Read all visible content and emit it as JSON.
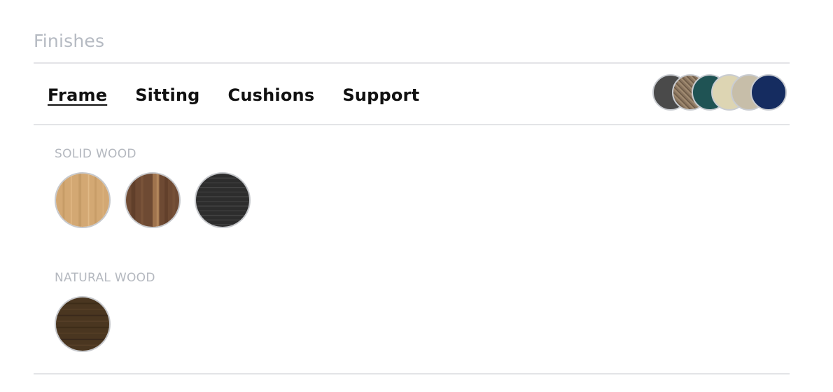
{
  "section": {
    "title": "Finishes"
  },
  "tabs": [
    {
      "label": "Frame",
      "active": true
    },
    {
      "label": "Sitting",
      "active": false
    },
    {
      "label": "Cushions",
      "active": false
    },
    {
      "label": "Support",
      "active": false
    }
  ],
  "preview_swatches": [
    {
      "name": "charcoal",
      "color": "#4a4a4a"
    },
    {
      "name": "tweed-brown",
      "color": "#8a7560"
    },
    {
      "name": "teal",
      "color": "#1f5354"
    },
    {
      "name": "cream",
      "color": "#ddd5b3"
    },
    {
      "name": "sand",
      "color": "#c7bea9"
    },
    {
      "name": "navy",
      "color": "#152c60"
    }
  ],
  "groups": [
    {
      "label": "SOLID WOOD",
      "swatches": [
        {
          "name": "oak-light",
          "color": "#d3a873",
          "grain": "#b98f5c"
        },
        {
          "name": "walnut",
          "color": "#6e4a33",
          "grain": "#a87a52"
        },
        {
          "name": "black-stained",
          "color": "#2d2d2d",
          "grain": "#444444"
        }
      ]
    },
    {
      "label": "NATURAL WOOD",
      "swatches": [
        {
          "name": "dark-oak",
          "color": "#4a3620",
          "grain": "#2f2213"
        }
      ]
    }
  ]
}
